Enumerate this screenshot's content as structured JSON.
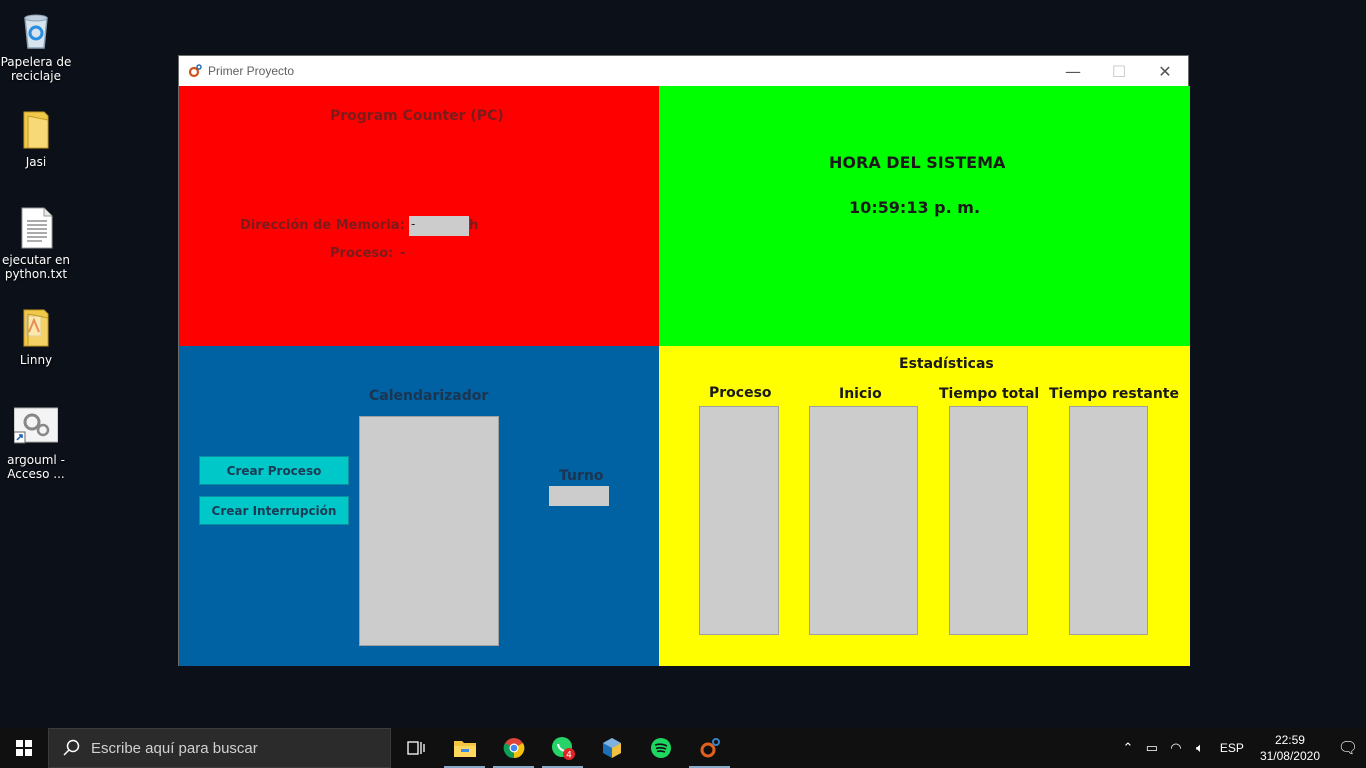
{
  "desktop": {
    "icons": [
      {
        "label": "Papelera de\nreciclaje",
        "icon": "recycle-bin-icon"
      },
      {
        "label": "Jasi",
        "icon": "folder-icon"
      },
      {
        "label": "ejecutar en\npython.txt",
        "icon": "text-file-icon"
      },
      {
        "label": "Linny",
        "icon": "folder-icon"
      },
      {
        "label": "argouml -\nAcceso ...",
        "icon": "shortcut-icon"
      }
    ]
  },
  "window": {
    "title": "Primer Proyecto",
    "controls": {
      "minimize": "—",
      "maximize": "☐",
      "close": "✕"
    }
  },
  "pc_panel": {
    "title": "Program Counter (PC)",
    "memory_label": "Dirección de Memoria:",
    "memory_value": "-",
    "memory_suffix": "h",
    "process_label": "Proceso:",
    "process_value": "-",
    "color": "#ff0000"
  },
  "clock_panel": {
    "title": "HORA DEL SISTEMA",
    "time": "10:59:13 p. m.",
    "color": "#00ff00"
  },
  "scheduler_panel": {
    "title": "Calendarizador",
    "create_process_button": "Crear Proceso",
    "create_interrupt_button": "Crear Interrupción",
    "turn_label": "Turno",
    "turn_value": "",
    "color": "#0061a3"
  },
  "stats_panel": {
    "title": "Estadísticas",
    "columns": [
      "Proceso",
      "Inicio",
      "Tiempo total",
      "Tiempo restante"
    ],
    "color": "#ffff00"
  },
  "taskbar": {
    "search_placeholder": "Escribe aquí para buscar",
    "apps": [
      {
        "icon": "task-view-icon"
      },
      {
        "icon": "file-explorer-icon"
      },
      {
        "icon": "chrome-icon"
      },
      {
        "icon": "whatsapp-icon",
        "badge": "4"
      },
      {
        "icon": "virtualbox-icon"
      },
      {
        "icon": "spotify-icon"
      },
      {
        "icon": "java-app-icon"
      }
    ],
    "language": "ESP",
    "time": "22:59",
    "date": "31/08/2020"
  }
}
